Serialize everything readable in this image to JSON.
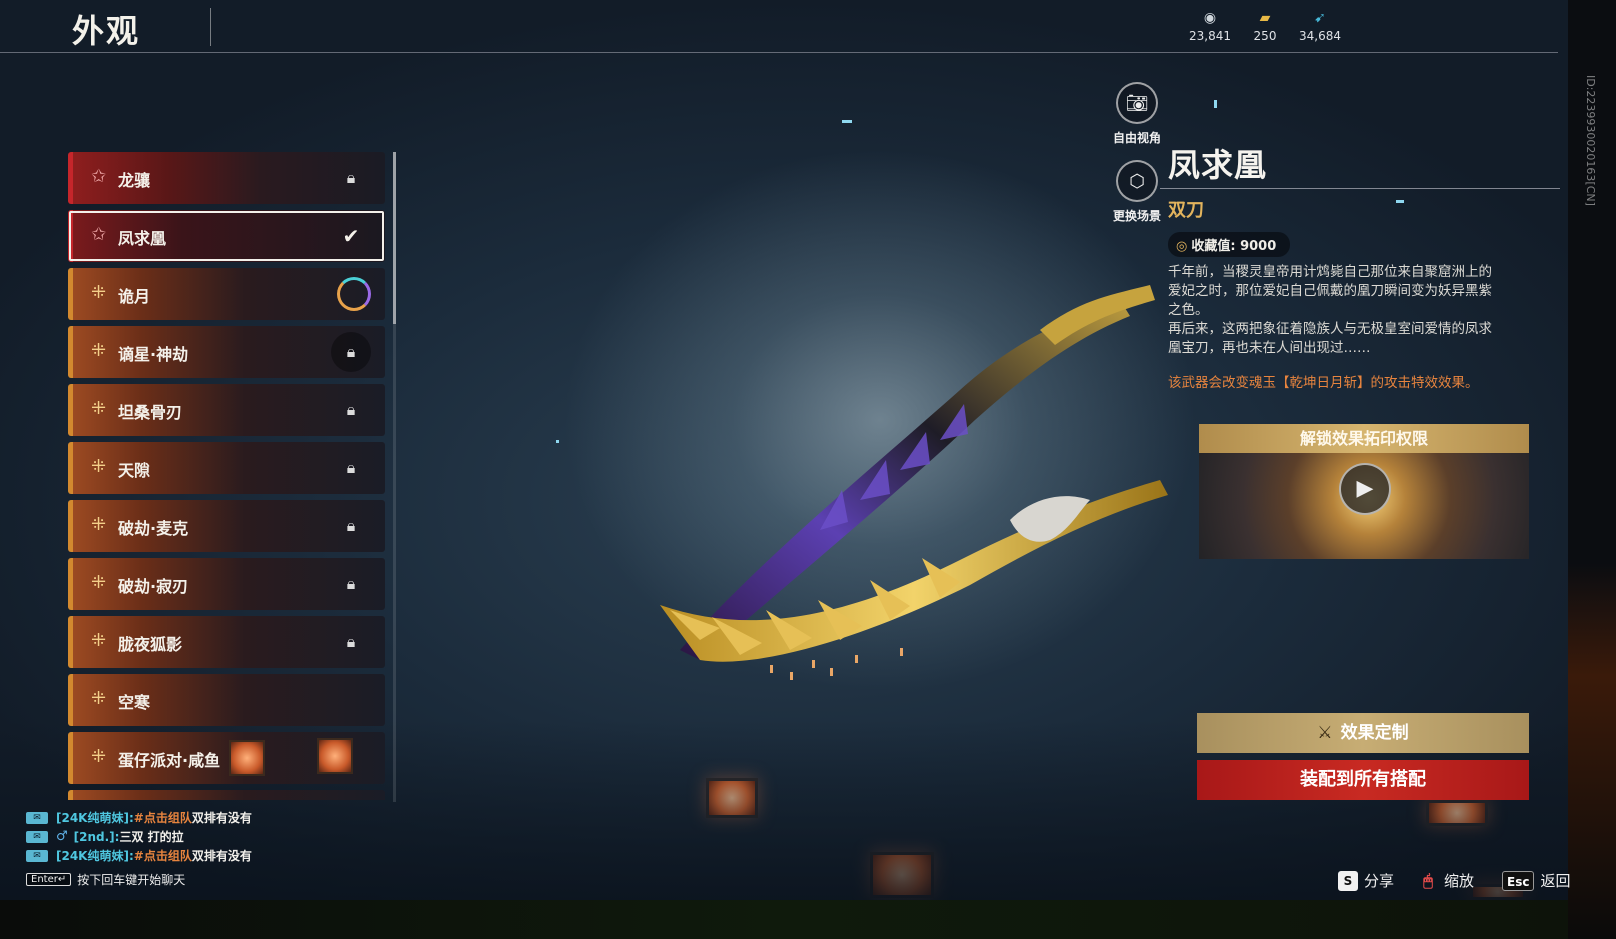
{
  "header": {
    "title": "外观",
    "currencies": [
      {
        "icon": "silver-coin-icon",
        "value": "23,841"
      },
      {
        "icon": "gold-ingot-icon",
        "value": "250"
      },
      {
        "icon": "feather-icon",
        "value": "34,684"
      }
    ]
  },
  "skins": [
    {
      "label": "龙骧",
      "rarity": "red",
      "status": "locked"
    },
    {
      "label": "凤求凰",
      "rarity": "red",
      "status": "equipped",
      "selected": true
    },
    {
      "label": "诡月",
      "rarity": "gold",
      "status": "in-progress"
    },
    {
      "label": "谪星·神劫",
      "rarity": "gold",
      "status": "locked"
    },
    {
      "label": "坦桑骨刃",
      "rarity": "gold",
      "status": "locked"
    },
    {
      "label": "天隙",
      "rarity": "gold",
      "status": "locked"
    },
    {
      "label": "破劫·麦克",
      "rarity": "gold",
      "status": "locked"
    },
    {
      "label": "破劫·寂刃",
      "rarity": "gold",
      "status": "locked"
    },
    {
      "label": "胧夜狐影",
      "rarity": "gold",
      "status": "locked"
    },
    {
      "label": "空寒",
      "rarity": "gold",
      "status": "none"
    },
    {
      "label": "蛋仔派对·咸鱼",
      "rarity": "gold",
      "status": "none"
    }
  ],
  "camera": {
    "free_view_label": "自由视角",
    "change_scene_label": "更换场景"
  },
  "detail": {
    "name": "凤求凰",
    "type": "双刀",
    "collection_label": "收藏值: 9000",
    "description_1": "千年前，当稷灵皇帝用计鸩毙自己那位来自聚窟洲上的爱妃之时，那位爱妃自己佩戴的凰刀瞬间变为妖异黑紫之色。",
    "description_2": "再后来，这两把象征着隐族人与无极皇室间爱情的凤求凰宝刀，再也未在人间出现过……",
    "note": "该武器会改变魂玉【乾坤日月斩】的攻击特效效果。",
    "unlock_label": "解锁效果拓印权限"
  },
  "actions": {
    "customize_label": "效果定制",
    "equip_all_label": "装配到所有搭配"
  },
  "chat": {
    "lines": [
      {
        "user": "[24K纯萌妹]:",
        "tag": "#点击组队",
        "text": " 双排有没有"
      },
      {
        "gender": "♂",
        "user": "[2nd.]:",
        "text": "三双 打的拉"
      },
      {
        "user": "[24K纯萌妹]:",
        "tag": "#点击组队",
        "text": " 双排有没有"
      }
    ],
    "enter_key": "Enter↵",
    "hint": "按下回车键开始聊天"
  },
  "hints": {
    "share_key": "S",
    "share_label": "分享",
    "zoom_label": "缩放",
    "back_key": "Esc",
    "back_label": "返回"
  },
  "version": "ID:2239930020163[CN]",
  "colors": {
    "accent_gold": "#e3b45d",
    "accent_red": "#c82a22",
    "note_orange": "#e7843e",
    "chat_user": "#4fc7e0"
  }
}
